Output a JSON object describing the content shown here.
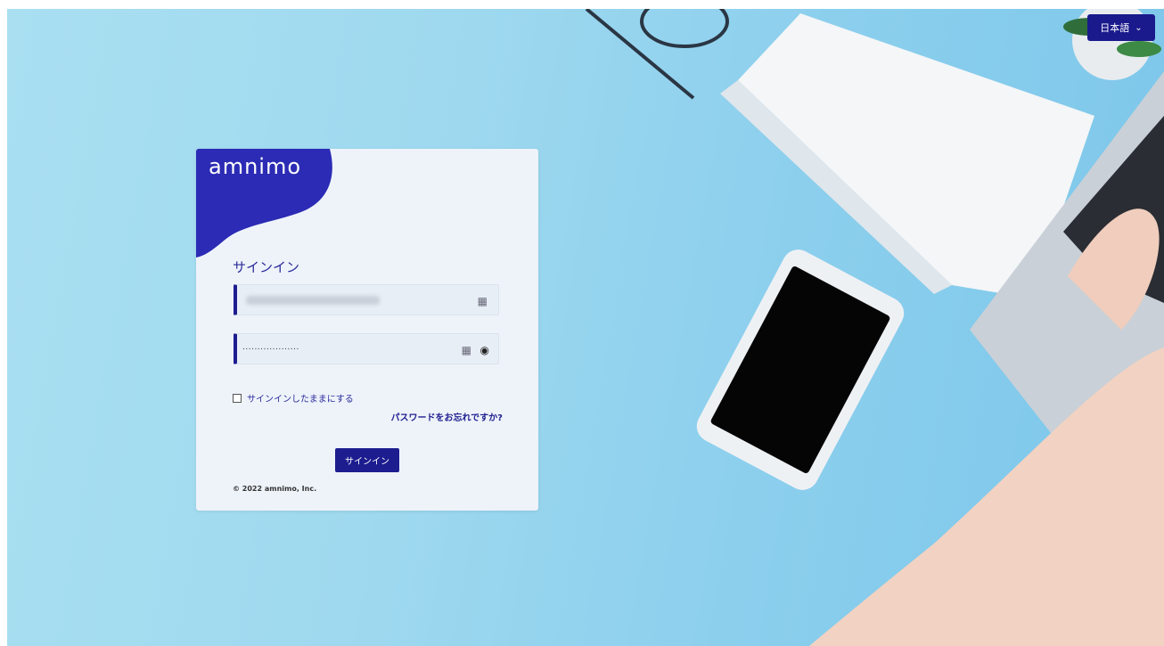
{
  "header": {
    "language_label": "日本語"
  },
  "card": {
    "logo_text": "amnimo",
    "title": "サインイン",
    "username_value_masked": "",
    "password_value": "...................",
    "keep_signed_in_label": "サインインしたままにする",
    "forgot_password_label": "パスワードをお忘れですか?",
    "signin_button_label": "サインイン",
    "copyright": "© 2022 amnimo, Inc."
  },
  "colors": {
    "accent": "#1d1d8f",
    "card_bg": "#eef3fa",
    "page_bg": "#9fd9ef"
  }
}
